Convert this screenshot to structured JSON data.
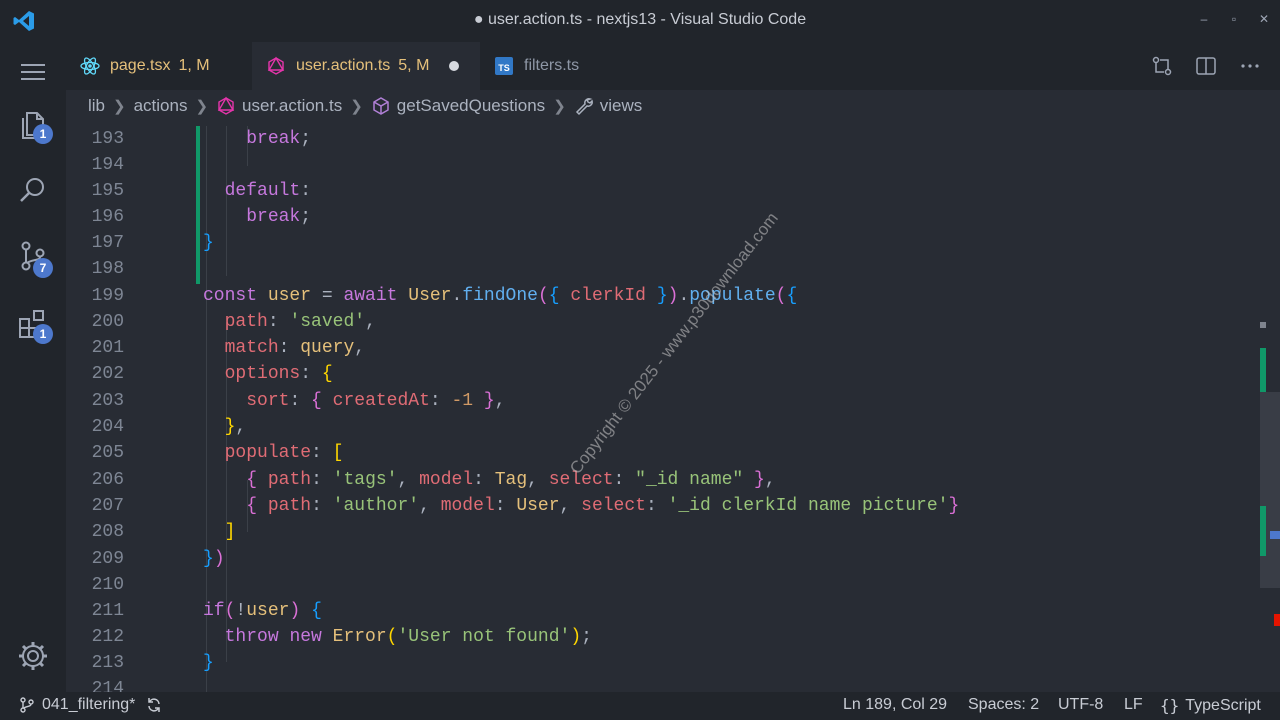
{
  "window": {
    "title": "● user.action.ts - nextjs13 - Visual Studio Code",
    "controls": [
      "–",
      "▫",
      "✕"
    ]
  },
  "activity_bar": {
    "explorer_badge": "1",
    "source_control_badge": "7",
    "extensions_badge": "1"
  },
  "tabs": [
    {
      "name": "page.tsx",
      "status": "1, M",
      "icon": "react-icon"
    },
    {
      "name": "user.action.ts",
      "status": "5, M",
      "icon": "graphql-icon",
      "active": true,
      "modified_dot": true
    },
    {
      "name": "filters.ts",
      "status": "",
      "icon": "typescript-icon"
    }
  ],
  "breadcrumb": [
    "lib",
    "actions",
    "user.action.ts",
    "getSavedQuestions",
    "views"
  ],
  "editor": {
    "line_numbers": [
      "193",
      "194",
      "195",
      "196",
      "197",
      "198",
      "199",
      "200",
      "201",
      "202",
      "203",
      "204",
      "205",
      "206",
      "207",
      "208",
      "209",
      "210",
      "211",
      "212",
      "213",
      "214"
    ]
  },
  "watermark": "Copyright © 2025 - www.p30download.com",
  "status_bar": {
    "branch": "041_filtering*",
    "position": "Ln 189, Col 29",
    "spaces": "Spaces: 2",
    "encoding": "UTF-8",
    "eol": "LF",
    "language": "TypeScript"
  }
}
